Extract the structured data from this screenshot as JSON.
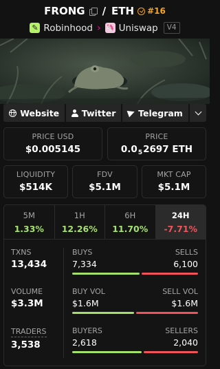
{
  "header": {
    "token": "FRONG",
    "slash": "/",
    "quote": "ETH",
    "trending_rank": "#16",
    "chain": "Robinhood",
    "chain_icon_glyph": "✎",
    "dex": "Uniswap",
    "dex_icon_glyph": "🦄",
    "version": "V4"
  },
  "links": {
    "website": "Website",
    "twitter": "Twitter",
    "telegram": "Telegram"
  },
  "prices": {
    "usd_label": "PRICE USD",
    "usd_value": "$0.005145",
    "native_label": "PRICE",
    "native_prefix": "0.0",
    "native_zeros": "5",
    "native_digits": "2697 ETH"
  },
  "metrics": {
    "liquidity_label": "LIQUIDITY",
    "liquidity_value": "$514K",
    "fdv_label": "FDV",
    "fdv_value": "$5.1M",
    "mcap_label": "MKT CAP",
    "mcap_value": "$5.1M"
  },
  "tabs": [
    {
      "label": "5M",
      "value": "1.33%"
    },
    {
      "label": "1H",
      "value": "12.26%"
    },
    {
      "label": "6H",
      "value": "11.70%"
    },
    {
      "label": "24H",
      "value": "-7.71%"
    }
  ],
  "stats": {
    "txns_label": "TXNS",
    "txns_value": "13,434",
    "volume_label": "VOLUME",
    "volume_value": "$3.3M",
    "traders_label": "TRADERS",
    "traders_value": "3,538",
    "buys_label": "BUYS",
    "buys_value": "7,334",
    "sells_label": "SELLS",
    "sells_value": "6,100",
    "buyvol_label": "BUY VOL",
    "buyvol_value": "$1.6M",
    "sellvol_label": "SELL VOL",
    "sellvol_value": "$1.6M",
    "buyers_label": "BUYERS",
    "buyers_value": "2,618",
    "sellers_label": "SELLERS",
    "sellers_value": "2,040"
  },
  "ratios": {
    "buys_share": 0.546,
    "buyvol_share": 0.5,
    "buyers_share": 0.562
  },
  "colors": {
    "positive": "#a6e06c",
    "negative": "#f0545a",
    "trending": "#f4a623",
    "chain": "#b6f16a",
    "dex": "#e0168d"
  },
  "icons": [
    "copy-icon",
    "trend-icon",
    "chain-icon",
    "dex-icon",
    "globe-icon",
    "person-icon",
    "plane-icon",
    "chevron-down-icon"
  ]
}
